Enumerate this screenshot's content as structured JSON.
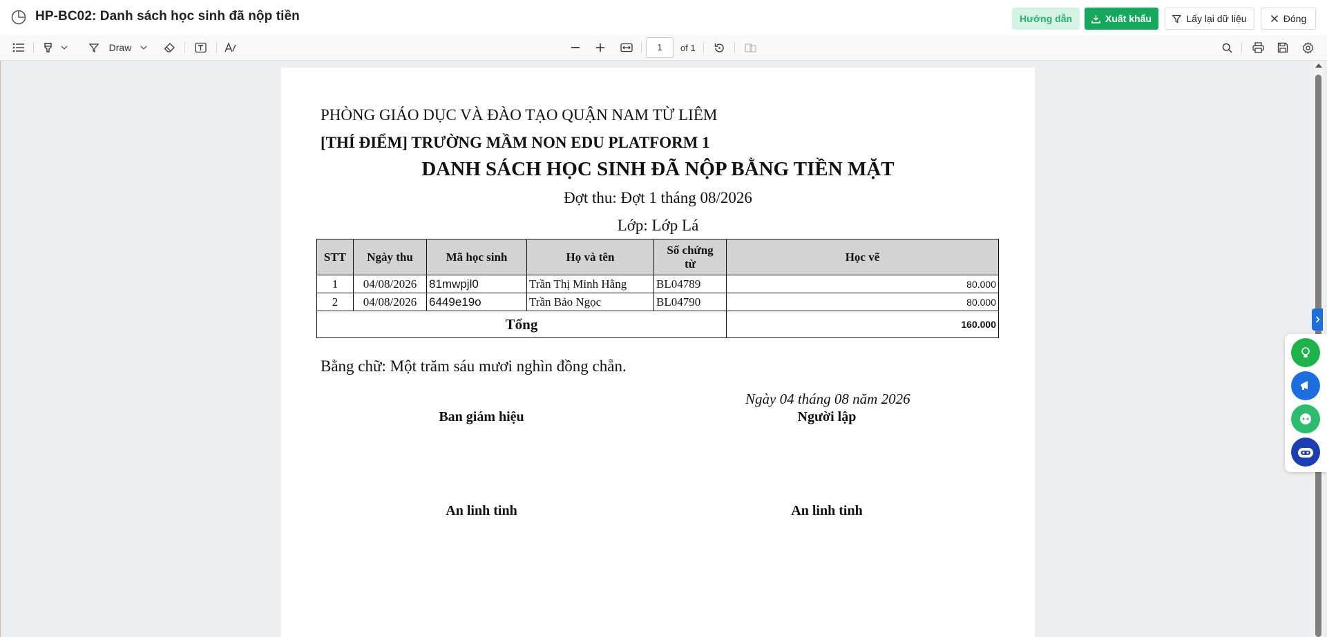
{
  "header": {
    "title": "HP-BC02: Danh sách học sinh đã nộp tiền",
    "buttons": {
      "guide": "Hướng dẫn",
      "export": "Xuất khẩu",
      "reload": "Lấy lại dữ liệu",
      "close": "Đóng"
    }
  },
  "toolbar": {
    "draw_label": "Draw",
    "page_number": "1",
    "page_total": "of 1"
  },
  "document": {
    "department": "PHÒNG GIÁO DỤC VÀ ĐÀO TẠO QUẬN NAM TỪ LIÊM",
    "school": "[THÍ ĐIỂM] TRƯỜNG MẦM NON EDU PLATFORM 1",
    "title": "DANH SÁCH HỌC SINH ĐÃ NỘP BẰNG TIỀN MẶT",
    "period": "Đợt thu: Đợt 1 tháng 08/2026",
    "class": "Lớp: Lớp Lá",
    "table": {
      "headers": [
        "STT",
        "Ngày thu",
        "Mã học sinh",
        "Họ và tên",
        "Số chứng từ",
        "Học vẽ"
      ],
      "rows": [
        {
          "stt": "1",
          "date": "04/08/2026",
          "code": "81mwpjl0",
          "name": "Trần Thị Minh Hằng",
          "voucher": "BL04789",
          "amount": "80.000"
        },
        {
          "stt": "2",
          "date": "04/08/2026",
          "code": "6449e19o",
          "name": "Trần Bảo Ngọc",
          "voucher": "BL04790",
          "amount": "80.000"
        }
      ],
      "total_label": "Tổng",
      "total_value": "160.000"
    },
    "in_words": "Bằng chữ: Một trăm sáu mươi nghìn đồng chẵn.",
    "date_line": "Ngày 04 tháng 08 năm 2026",
    "signatures": {
      "left_title": "Ban giám hiệu",
      "right_title": "Người lập",
      "left_name": "An linh tinh",
      "right_name": "An linh tinh"
    }
  },
  "colors": {
    "brand_green": "#13a85c",
    "guide_bg": "#d5f3e4",
    "table_header_bg": "#d3d3d3",
    "side_toggle": "#1d6fe0"
  },
  "icons": {
    "app": "pie-chart-icon",
    "export": "download-icon",
    "reload": "filter-icon",
    "close": "close-icon"
  }
}
